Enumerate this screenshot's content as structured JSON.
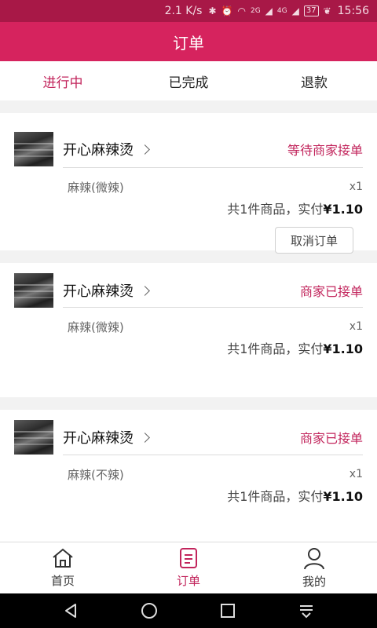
{
  "status_bar": {
    "speed": "2.1 K/s",
    "net1": "2G",
    "net2": "4G",
    "battery": "37",
    "time": "15:56"
  },
  "header": {
    "title": "订单"
  },
  "tabs": [
    {
      "label": "进行中",
      "active": true
    },
    {
      "label": "已完成",
      "active": false
    },
    {
      "label": "退款",
      "active": false
    }
  ],
  "orders": [
    {
      "shop": "开心麻辣烫",
      "status": "等待商家接单",
      "item": "麻辣(微辣)",
      "qty": "x1",
      "total_prefix": "共1件商品，实付",
      "total_price": "¥1.10",
      "action": "取消订单"
    },
    {
      "shop": "开心麻辣烫",
      "status": "商家已接单",
      "item": "麻辣(微辣)",
      "qty": "x1",
      "total_prefix": "共1件商品，实付",
      "total_price": "¥1.10"
    },
    {
      "shop": "开心麻辣烫",
      "status": "商家已接单",
      "item": "麻辣(不辣)",
      "qty": "x1",
      "total_prefix": "共1件商品，实付",
      "total_price": "¥1.10"
    }
  ],
  "bottom_nav": [
    {
      "label": "首页",
      "icon": "home-icon",
      "active": false
    },
    {
      "label": "订单",
      "icon": "order-list-icon",
      "active": true
    },
    {
      "label": "我的",
      "icon": "profile-icon",
      "active": false
    }
  ],
  "colors": {
    "accent": "#d6235e",
    "status_bar": "#a81847",
    "active_text": "#c2255c"
  }
}
